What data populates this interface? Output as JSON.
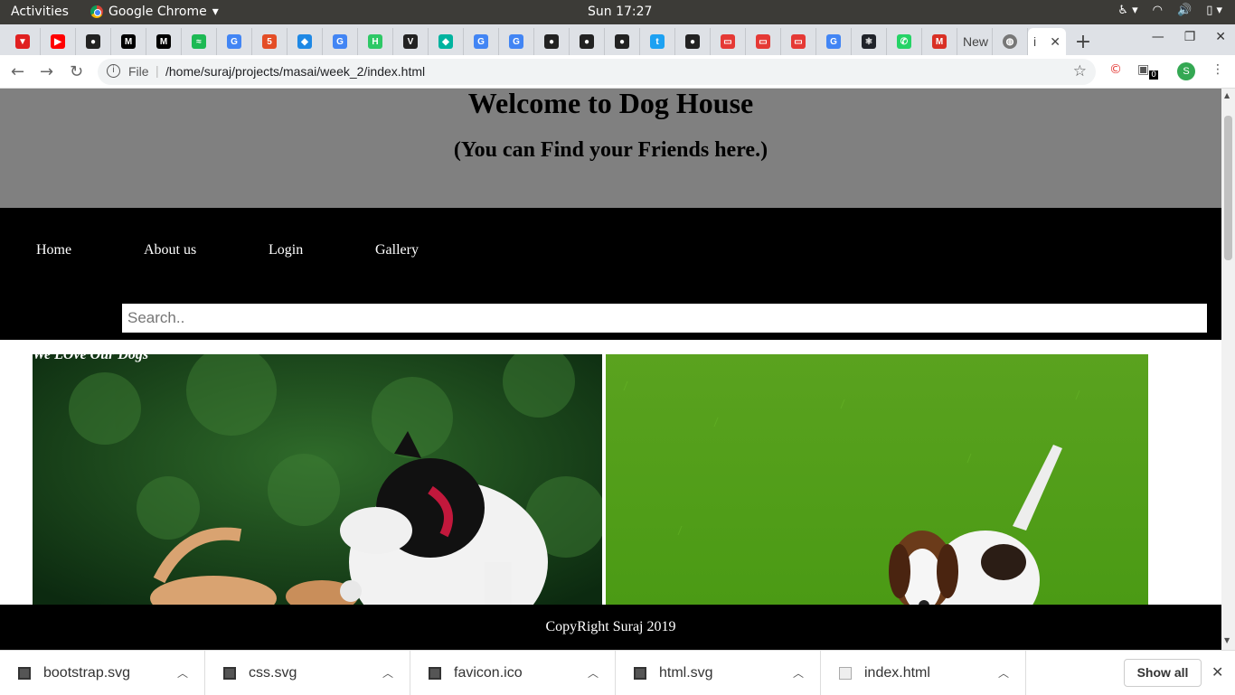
{
  "system": {
    "activities": "Activities",
    "app_name": "Google Chrome",
    "clock": "Sun 17:27"
  },
  "tabs": {
    "items": [
      {
        "icon": "vivaldi-icon",
        "color": "#e02020",
        "glyph": "▼"
      },
      {
        "icon": "youtube-icon",
        "color": "#ff0000",
        "glyph": "▶"
      },
      {
        "icon": "github-icon",
        "color": "#222222",
        "glyph": "●"
      },
      {
        "icon": "medium-icon",
        "color": "#000000",
        "glyph": "M"
      },
      {
        "icon": "medium-icon",
        "color": "#000000",
        "glyph": "M"
      },
      {
        "icon": "spotify-icon",
        "color": "#1db954",
        "glyph": "≈"
      },
      {
        "icon": "google-icon",
        "color": "#4285f4",
        "glyph": "G"
      },
      {
        "icon": "html5-icon",
        "color": "#e44d26",
        "glyph": "5"
      },
      {
        "icon": "bookmark-icon",
        "color": "#1e88e5",
        "glyph": "◆"
      },
      {
        "icon": "google-icon",
        "color": "#4285f4",
        "glyph": "G"
      },
      {
        "icon": "hackerrank-icon",
        "color": "#2ec866",
        "glyph": "H"
      },
      {
        "icon": "vue-icon",
        "color": "#222222",
        "glyph": "V"
      },
      {
        "icon": "diamond-icon",
        "color": "#00b39f",
        "glyph": "◆"
      },
      {
        "icon": "google-icon",
        "color": "#4285f4",
        "glyph": "G"
      },
      {
        "icon": "google-icon",
        "color": "#4285f4",
        "glyph": "G"
      },
      {
        "icon": "github-icon",
        "color": "#222222",
        "glyph": "●"
      },
      {
        "icon": "github-icon",
        "color": "#222222",
        "glyph": "●"
      },
      {
        "icon": "github-icon",
        "color": "#222222",
        "glyph": "●"
      },
      {
        "icon": "twitter-icon",
        "color": "#1da1f2",
        "glyph": "t"
      },
      {
        "icon": "github-icon",
        "color": "#222222",
        "glyph": "●"
      },
      {
        "icon": "youtube-thumb-icon",
        "color": "#e53935",
        "glyph": "▭"
      },
      {
        "icon": "youtube-thumb-icon",
        "color": "#e53935",
        "glyph": "▭"
      },
      {
        "icon": "youtube-thumb-icon",
        "color": "#e53935",
        "glyph": "▭"
      },
      {
        "icon": "google-icon",
        "color": "#4285f4",
        "glyph": "G"
      },
      {
        "icon": "react-icon",
        "color": "#20232a",
        "glyph": "⚛"
      },
      {
        "icon": "whatsapp-icon",
        "color": "#25d366",
        "glyph": "✆"
      },
      {
        "icon": "gmail-icon",
        "color": "#d93025",
        "glyph": "M"
      }
    ],
    "text_tab": "New",
    "active_tab_label": "i"
  },
  "toolbar": {
    "file_label": "File",
    "url": "/home/suraj/projects/masai/week_2/index.html",
    "extension_count": "0",
    "avatar_letter": "S"
  },
  "page": {
    "title": "Welcome to Dog House",
    "subtitle": "(You can Find your Friends here.)",
    "nav": [
      "Home",
      "About us",
      "Login",
      "Gallery"
    ],
    "search_placeholder": "Search..",
    "gallery_caption": "We LOve Our Dogs",
    "footer": "CopyRight Suraj 2019"
  },
  "downloads": {
    "items": [
      "bootstrap.svg",
      "css.svg",
      "favicon.ico",
      "html.svg",
      "index.html"
    ],
    "show_all": "Show all"
  }
}
